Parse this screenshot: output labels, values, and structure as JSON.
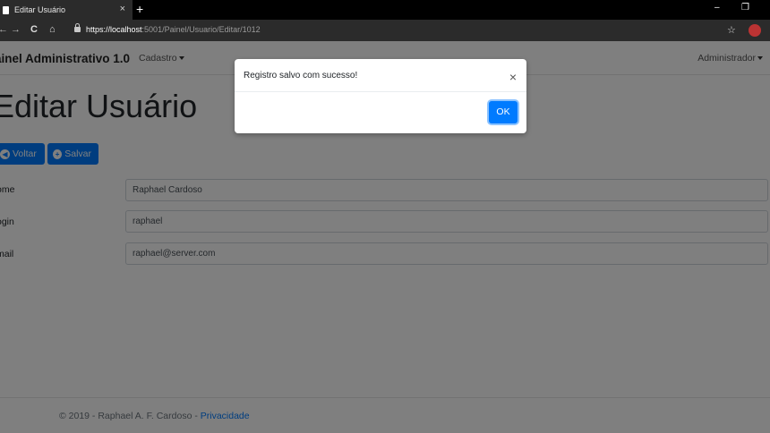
{
  "browser": {
    "tab_title": "Editar Usuário",
    "tab_close": "×",
    "new_tab": "+",
    "url_host": "https://localhost",
    "url_path": ":5001/Painel/Usuario/Editar/1012",
    "minimize": "–",
    "restore": "❐",
    "star": "☆",
    "back": "←",
    "forward": "→",
    "reload": "C",
    "home": "⌂"
  },
  "navbar": {
    "brand": "ainel Administrativo 1.0",
    "cadastro": "Cadastro",
    "admin": "Administrador"
  },
  "page": {
    "title": "Editar Usuário"
  },
  "buttons": {
    "voltar": "Voltar",
    "salvar": "Salvar"
  },
  "form": {
    "nome_label": "ome",
    "nome_value": "Raphael Cardoso",
    "login_label": "ogin",
    "login_value": "raphael",
    "email_label": "mail",
    "email_value": "raphael@server.com"
  },
  "footer": {
    "text": "© 2019 - Raphael A. F. Cardoso - ",
    "link": "Privacidade"
  },
  "modal": {
    "message": "Registro salvo com sucesso!",
    "close": "×",
    "ok": "OK"
  }
}
